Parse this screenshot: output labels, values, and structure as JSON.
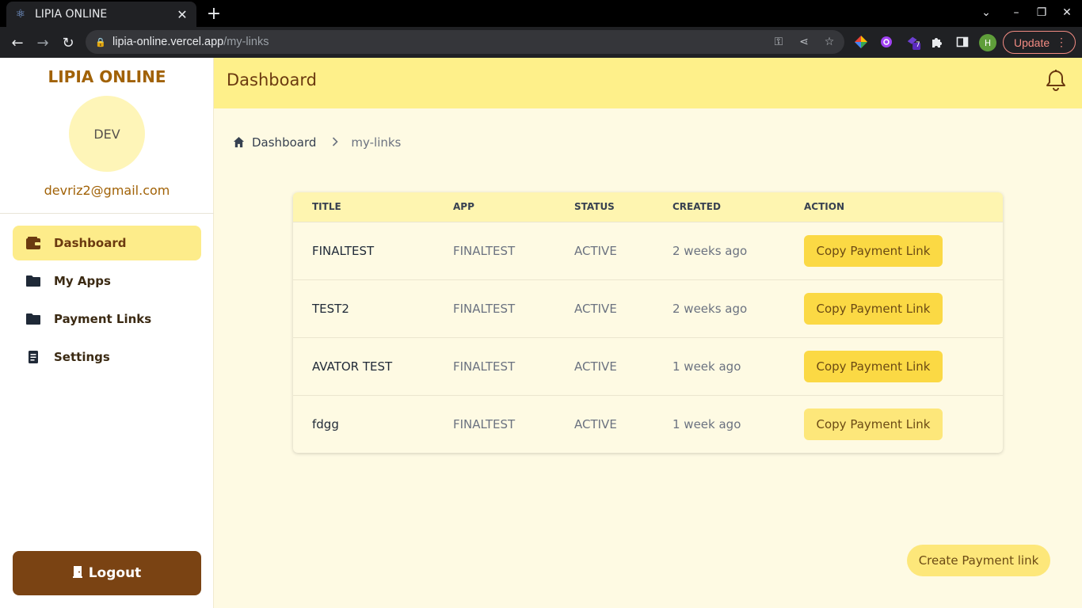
{
  "browser": {
    "tab_title": "LIPIA ONLINE",
    "url_host": "lipia-online.vercel.app",
    "url_path": "/my-links",
    "update_label": "Update",
    "profile_initial": "H",
    "extension_badge": "7"
  },
  "sidebar": {
    "brand": "LIPIA ONLINE",
    "avatar_text": "DEV",
    "email": "devriz2@gmail.com",
    "items": [
      {
        "label": "Dashboard",
        "icon": "wallet-icon",
        "active": true
      },
      {
        "label": "My Apps",
        "icon": "folder-icon",
        "active": false
      },
      {
        "label": "Payment Links",
        "icon": "folder-icon",
        "active": false
      },
      {
        "label": "Settings",
        "icon": "document-icon",
        "active": false
      }
    ],
    "logout_label": "Logout"
  },
  "header": {
    "title": "Dashboard"
  },
  "breadcrumb": {
    "home": "Dashboard",
    "current": "my-links"
  },
  "table": {
    "columns": [
      "TITLE",
      "APP",
      "STATUS",
      "CREATED",
      "ACTION"
    ],
    "rows": [
      {
        "title": "FINALTEST",
        "app": "FINALTEST",
        "status": "ACTIVE",
        "created": "2 weeks ago",
        "action": "Copy Payment Link"
      },
      {
        "title": "TEST2",
        "app": "FINALTEST",
        "status": "ACTIVE",
        "created": "2 weeks ago",
        "action": "Copy Payment Link"
      },
      {
        "title": "AVATOR TEST",
        "app": "FINALTEST",
        "status": "ACTIVE",
        "created": "1 week ago",
        "action": "Copy Payment Link"
      },
      {
        "title": "fdgg",
        "app": "FINALTEST",
        "status": "ACTIVE",
        "created": "1 week ago",
        "action": "Copy Payment Link"
      }
    ]
  },
  "create_button": "Create Payment link",
  "colors": {
    "brand": "#a16207",
    "header_bg": "#fef08a",
    "button_bg": "#fbd944",
    "logout_bg": "#7a4313"
  }
}
